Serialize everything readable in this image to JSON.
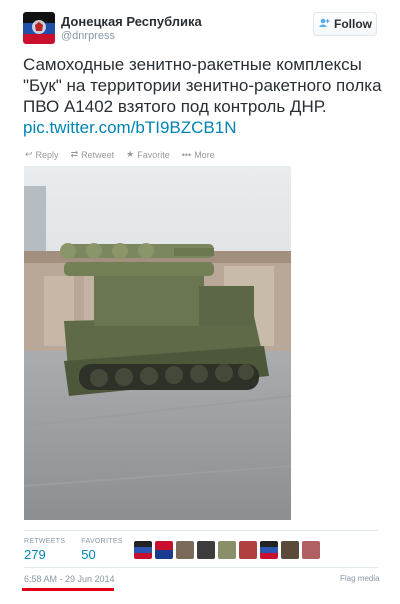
{
  "author": {
    "display_name": "Донецкая Республика",
    "username": "@dnrpress",
    "avatar_icon": "flag-avatar"
  },
  "follow": {
    "label": "Follow",
    "icon": "add-user-icon"
  },
  "tweet": {
    "text": "Самоходные зенитно-ракетные комплексы \"Бук\" на территории зенитно-ракетного полка ПВО А1402 взятого под контроль ДНР. ",
    "link": "pic.twitter.com/bTI9BZCB1N"
  },
  "actions": [
    {
      "label": "Reply",
      "icon": "reply-icon"
    },
    {
      "label": "Retweet",
      "icon": "retweet-icon"
    },
    {
      "label": "Favorite",
      "icon": "star-icon"
    },
    {
      "label": "More",
      "icon": "more-icon"
    }
  ],
  "stats": {
    "retweets_label": "RETWEETS",
    "retweets_value": "279",
    "favorites_label": "FAVORITES",
    "favorites_value": "50"
  },
  "timestamp": "6:58 AM - 29 Jun 2014",
  "flag_media": "Flag media",
  "colors": {
    "link": "#0084b4",
    "underline": "#e3001b"
  }
}
